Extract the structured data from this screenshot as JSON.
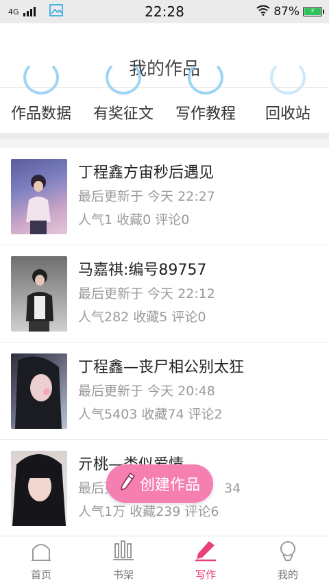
{
  "status_bar": {
    "network": "4G",
    "time": "22:28",
    "battery_percent": "87%",
    "icons": [
      "signal-icon",
      "gallery-icon",
      "wifi-icon",
      "battery-icon"
    ]
  },
  "header": {
    "title": "我的作品"
  },
  "quick_nav": {
    "items": [
      {
        "label": "作品数据"
      },
      {
        "label": "有奖征文"
      },
      {
        "label": "写作教程"
      },
      {
        "label": "回收站"
      }
    ]
  },
  "works": [
    {
      "title": "丁程鑫方宙秒后遇见",
      "updated": "最后更新于 今天 22:27",
      "popularity": "人气1",
      "favorites": "收藏0",
      "comments": "评论0"
    },
    {
      "title": "马嘉祺:编号89757",
      "updated": "最后更新于 今天 22:12",
      "popularity": "人气282",
      "favorites": "收藏5",
      "comments": "评论0"
    },
    {
      "title": "丁程鑫—丧尸相公别太狂",
      "updated": "最后更新于 今天 20:48",
      "popularity": "人气5403",
      "favorites": "收藏74",
      "comments": "评论2"
    },
    {
      "title": "亓桃—类似爱情",
      "updated": "最后更新于",
      "updated_tail": "34",
      "popularity": "人气1万",
      "favorites": "收藏239",
      "comments": "评论6"
    }
  ],
  "fab": {
    "label": "创建作品"
  },
  "tabbar": {
    "items": [
      {
        "label": "首页"
      },
      {
        "label": "书架"
      },
      {
        "label": "写作"
      },
      {
        "label": "我的"
      }
    ],
    "active_color": "#e8407a"
  },
  "colors": {
    "accent_pink": "#f57fb1",
    "nav_arc_blue": "#9fd4f5",
    "battery_green": "#2ec35a"
  }
}
